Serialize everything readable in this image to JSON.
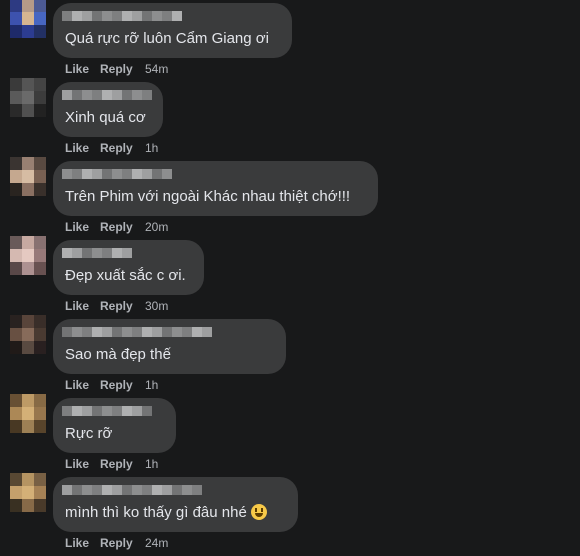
{
  "comments": [
    {
      "text": "Quá rực rỡ luôn Cẩm Giang ơi",
      "like": "Like",
      "reply": "Reply",
      "time": "54m",
      "avatar_colors": [
        "#2b3a8a",
        "#b89a86",
        "#4a5a9a",
        "#3a52b8",
        "#d9b48c",
        "#4466cc",
        "#1c2a70",
        "#2a3c9a",
        "#20306a"
      ]
    },
    {
      "text": "Xinh quá cơ",
      "like": "Like",
      "reply": "Reply",
      "time": "1h",
      "avatar_colors": [
        "#3a3a3a",
        "#555",
        "#444",
        "#5a5a5a",
        "#6a6a6a",
        "#3c3c3c",
        "#2a2a2a",
        "#505050",
        "#222"
      ]
    },
    {
      "text": "Trên Phim với ngoài Khác nhau thiệt chớ!!!",
      "like": "Like",
      "reply": "Reply",
      "time": "20m",
      "avatar_colors": [
        "#3b3430",
        "#9a8070",
        "#5a4a40",
        "#c8a88c",
        "#d8bca0",
        "#7a6050",
        "#2a2420",
        "#8c7060",
        "#3a302a"
      ]
    },
    {
      "text": "Đẹp xuất sắc c ơi.",
      "like": "Like",
      "reply": "Reply",
      "time": "30m",
      "avatar_colors": [
        "#6a5a58",
        "#caa8a0",
        "#8a7070",
        "#d8b8b0",
        "#e8c8c0",
        "#9a7878",
        "#5a4848",
        "#b09090",
        "#6a5050"
      ]
    },
    {
      "text": "Sao mà đẹp thế",
      "like": "Like",
      "reply": "Reply",
      "time": "1h",
      "avatar_colors": [
        "#2a2220",
        "#5a4438",
        "#3a2e28",
        "#6a5040",
        "#8a6a58",
        "#4a3a30",
        "#201a18",
        "#5a4a40",
        "#2a2020"
      ]
    },
    {
      "text": "Rực rỡ",
      "like": "Like",
      "reply": "Reply",
      "time": "1h",
      "avatar_colors": [
        "#6a5030",
        "#c09a60",
        "#8a6a40",
        "#b08850",
        "#d8b070",
        "#9a7648",
        "#4a3820",
        "#a08050",
        "#5a4428"
      ]
    },
    {
      "text": "mình thì ko thấy gì đâu nhé",
      "like": "Like",
      "reply": "Reply",
      "time": "24m",
      "emoji": "grinning-face",
      "avatar_colors": [
        "#5a4830",
        "#b8945c",
        "#7a6040",
        "#c8a066",
        "#d8b070",
        "#a88050",
        "#3a3020",
        "#8a6a44",
        "#4a3a28"
      ]
    }
  ]
}
